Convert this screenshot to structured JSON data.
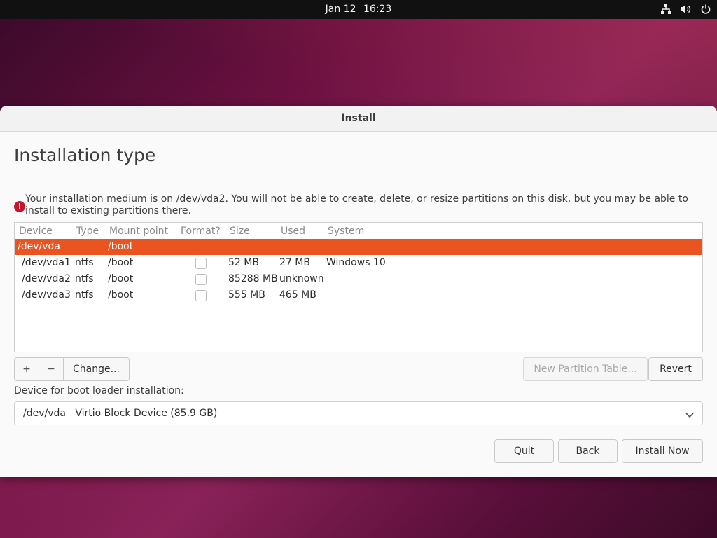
{
  "topbar": {
    "date": "Jan 12",
    "time": "16:23",
    "icons": [
      "network-icon",
      "volume-icon",
      "power-icon"
    ]
  },
  "window": {
    "title": "Install",
    "heading": "Installation type"
  },
  "warning": {
    "icon": "error-icon",
    "text": "Your installation medium is on /dev/vda2. You will not be able to create, delete, or resize partitions on this disk, but you may be able to install to existing partitions there."
  },
  "table": {
    "columns": [
      "Device",
      "Type",
      "Mount point",
      "Format?",
      "Size",
      "Used",
      "System"
    ],
    "rows": [
      {
        "device": "/dev/vda",
        "type": "",
        "mount": "/boot",
        "format": false,
        "size": "",
        "used": "",
        "system": "",
        "selected": true,
        "is_disk": true
      },
      {
        "device": "/dev/vda1",
        "type": "ntfs",
        "mount": "/boot",
        "format": false,
        "size": "52 MB",
        "used": "27 MB",
        "system": "Windows 10",
        "selected": false,
        "is_disk": false
      },
      {
        "device": "/dev/vda2",
        "type": "ntfs",
        "mount": "/boot",
        "format": false,
        "size": "85288 MB",
        "used": "unknown",
        "system": "",
        "selected": false,
        "is_disk": false
      },
      {
        "device": "/dev/vda3",
        "type": "ntfs",
        "mount": "/boot",
        "format": false,
        "size": "555 MB",
        "used": "465 MB",
        "system": "",
        "selected": false,
        "is_disk": false
      }
    ]
  },
  "toolbar": {
    "add_label": "+",
    "remove_label": "−",
    "change_label": "Change...",
    "new_table_label": "New Partition Table...",
    "revert_label": "Revert"
  },
  "bootloader": {
    "label": "Device for boot loader installation:",
    "device": "/dev/vda",
    "description": "Virtio Block Device (85.9 GB)"
  },
  "actions": {
    "quit_label": "Quit",
    "back_label": "Back",
    "install_label": "Install Now"
  },
  "colors": {
    "accent": "#e95420",
    "error": "#c7162b"
  }
}
